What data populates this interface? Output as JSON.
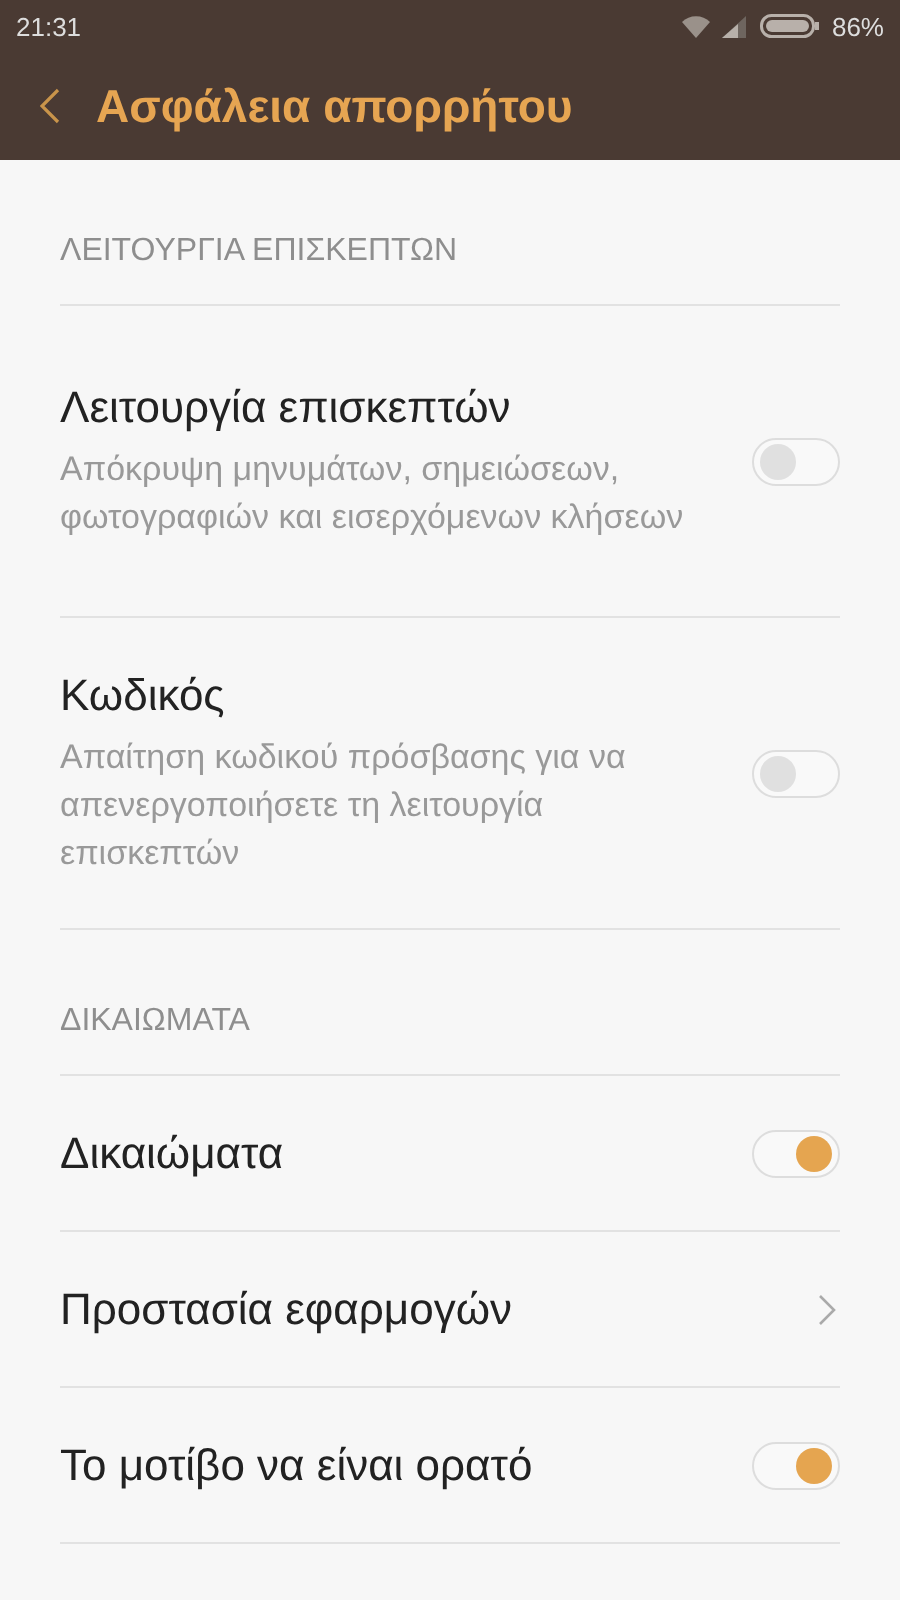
{
  "status_bar": {
    "time": "21:31",
    "battery": "86%"
  },
  "header": {
    "title": "Ασφάλεια απορρήτου"
  },
  "sections": [
    {
      "title": "ΛΕΙΤΟΥΡΓΙΑ ΕΠΙΣΚΕΠΤΩΝ",
      "items": [
        {
          "kind": "toggle",
          "label": "Λειτουργία επισκεπτών",
          "description": "Απόκρυψη μηνυμάτων, σημειώσεων, φωτογραφιών και εισερχόμενων κλήσεων",
          "on": false
        },
        {
          "kind": "toggle",
          "label": "Κωδικός",
          "description": "Απαίτηση κωδικού πρόσβασης για να απενεργοποιήσετε τη λειτουργία επισκεπτών",
          "on": false
        }
      ]
    },
    {
      "title": "ΔΙΚΑΙΩΜΑΤΑ",
      "items": [
        {
          "kind": "toggle",
          "label": "Δικαιώματα",
          "on": true
        },
        {
          "kind": "link",
          "label": "Προστασία εφαρμογών"
        },
        {
          "kind": "toggle",
          "label": "Το μοτίβο να είναι ορατό",
          "on": true
        }
      ]
    }
  ]
}
